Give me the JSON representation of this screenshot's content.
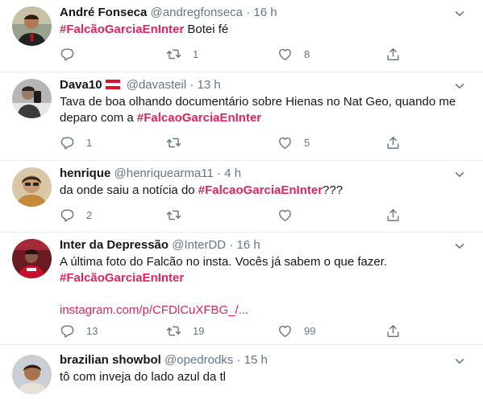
{
  "tweets": [
    {
      "name": "André Fonseca",
      "handle": "@andregfonseca",
      "dot": "·",
      "time": "16 h",
      "text_pre": "",
      "hashtag": "#FalcãoGarciaEnInter",
      "text_post": " Botei fé",
      "replies": "",
      "retweets": "1",
      "likes": "8"
    },
    {
      "name": "Dava10",
      "handle": "@davasteil",
      "dot": "·",
      "time": "13 h",
      "text_pre": "Tava de boa olhando documentário sobre Hienas no Nat Geo, quando me deparo com a ",
      "hashtag": "#FalcaoGarciaEnInter",
      "text_post": "",
      "replies": "1",
      "retweets": "",
      "likes": "5"
    },
    {
      "name": "henrique",
      "handle": "@henriquearma11",
      "dot": "·",
      "time": "4 h",
      "text_pre": "da onde saiu a notícia do ",
      "hashtag": "#FalcaoGarciaEnInter",
      "text_post": "???",
      "replies": "2",
      "retweets": "",
      "likes": ""
    },
    {
      "name": "Inter da Depressão",
      "handle": "@InterDD",
      "dot": "·",
      "time": "16 h",
      "text_pre": "A última foto do Falcão no insta. Vocês já sabem o que fazer.",
      "hashtag": "#FalcãoGarciaEnInter",
      "link": "instagram.com/p/CFDlCuXFBG_/...",
      "replies": "13",
      "retweets": "19",
      "likes": "99"
    },
    {
      "name": "brazilian showbol",
      "handle": "@opedrodks",
      "dot": "·",
      "time": "15 h",
      "text_pre": "tô com inveja do lado azul da tl"
    }
  ],
  "colors": {
    "accent": "#e0245e",
    "muted": "#657786",
    "text": "#14171a",
    "divider": "#e6ecf0"
  },
  "icons": [
    "reply-icon",
    "retweet-icon",
    "like-icon",
    "share-icon",
    "chevron-down-icon",
    "austria-flag-icon"
  ]
}
